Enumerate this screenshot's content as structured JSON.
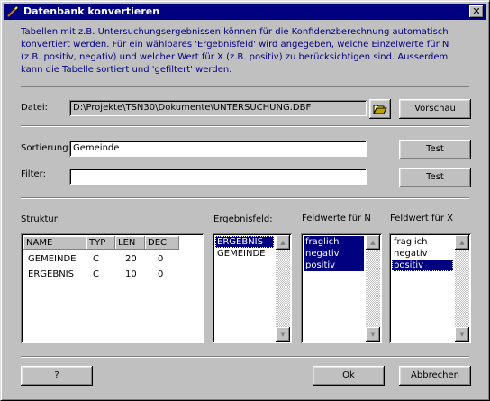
{
  "window": {
    "title": "Datenbank konvertieren",
    "close_glyph": "✕"
  },
  "description": "Tabellen mit z.B. Untersuchungsergebnissen können für die Konfidenzberechnung automatisch konvertiert werden. Für ein wählbares 'Ergebnisfeld' wird angegeben, welche Einzelwerte für N (z.B. positiv, negativ) und welcher Wert für X (z.B. positiv) zu berücksichtigen sind. Ausserdem kann die Tabelle sortiert und 'gefiltert' werden.",
  "file": {
    "label": "Datei:",
    "value": "D:\\Projekte\\TSN30\\Dokumente\\UNTERSUCHUNG.DBF",
    "open_icon": "folder-open-icon",
    "preview_label": "Vorschau"
  },
  "sort": {
    "label": "Sortierung:",
    "value": "Gemeinde",
    "test_label": "Test"
  },
  "filter": {
    "label": "Filter:",
    "value": "",
    "test_label": "Test"
  },
  "structure": {
    "label": "Struktur:",
    "columns": [
      "NAME",
      "TYP",
      "LEN",
      "DEC"
    ],
    "rows": [
      [
        "GEMEINDE",
        "C",
        "20",
        "0"
      ],
      [
        "ERGEBNIS",
        "C",
        "10",
        "0"
      ]
    ]
  },
  "result_field": {
    "label": "Ergebnisfeld:",
    "items": [
      "ERGEBNIS",
      "GEMEINDE"
    ],
    "selected": [
      0
    ]
  },
  "values_n": {
    "label": "Feldwerte für N",
    "items": [
      "fraglich",
      "negativ",
      "positiv"
    ],
    "selected": [
      0,
      1,
      2
    ]
  },
  "value_x": {
    "label": "Feldwert für X",
    "items": [
      "fraglich",
      "negativ",
      "positiv"
    ],
    "selected": [
      2
    ]
  },
  "footer": {
    "help_label": "?",
    "ok_label": "Ok",
    "cancel_label": "Abbrechen"
  },
  "colors": {
    "titlebar": "#000080",
    "face": "#c0c0c0",
    "selection": "#000080",
    "description_text": "#000080"
  }
}
